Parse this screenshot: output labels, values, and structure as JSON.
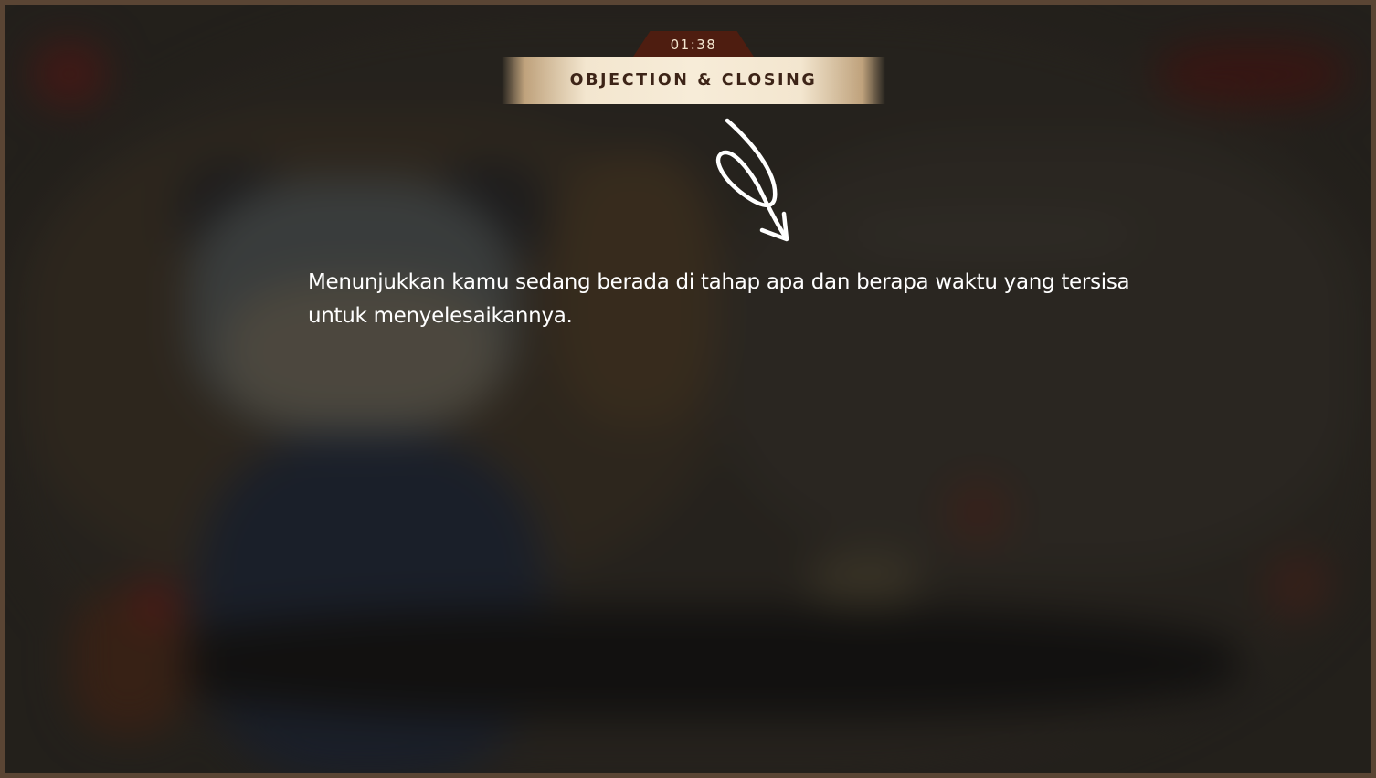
{
  "hud": {
    "timer": "01:38",
    "stage": "OBJECTION & CLOSING"
  },
  "tutorial": {
    "text": "Menunjukkan kamu sedang berada di tahap apa dan berapa waktu yang tersisa untuk menyelesaikannya.",
    "pointer_icon": "hand-drawn-loop-arrow-down-icon"
  },
  "colors": {
    "frame": "#5a4534",
    "timer_tab": "#4e1d10",
    "banner": "#f3e6cf",
    "banner_text": "#3d2417",
    "tutorial_text": "#ffffff"
  }
}
